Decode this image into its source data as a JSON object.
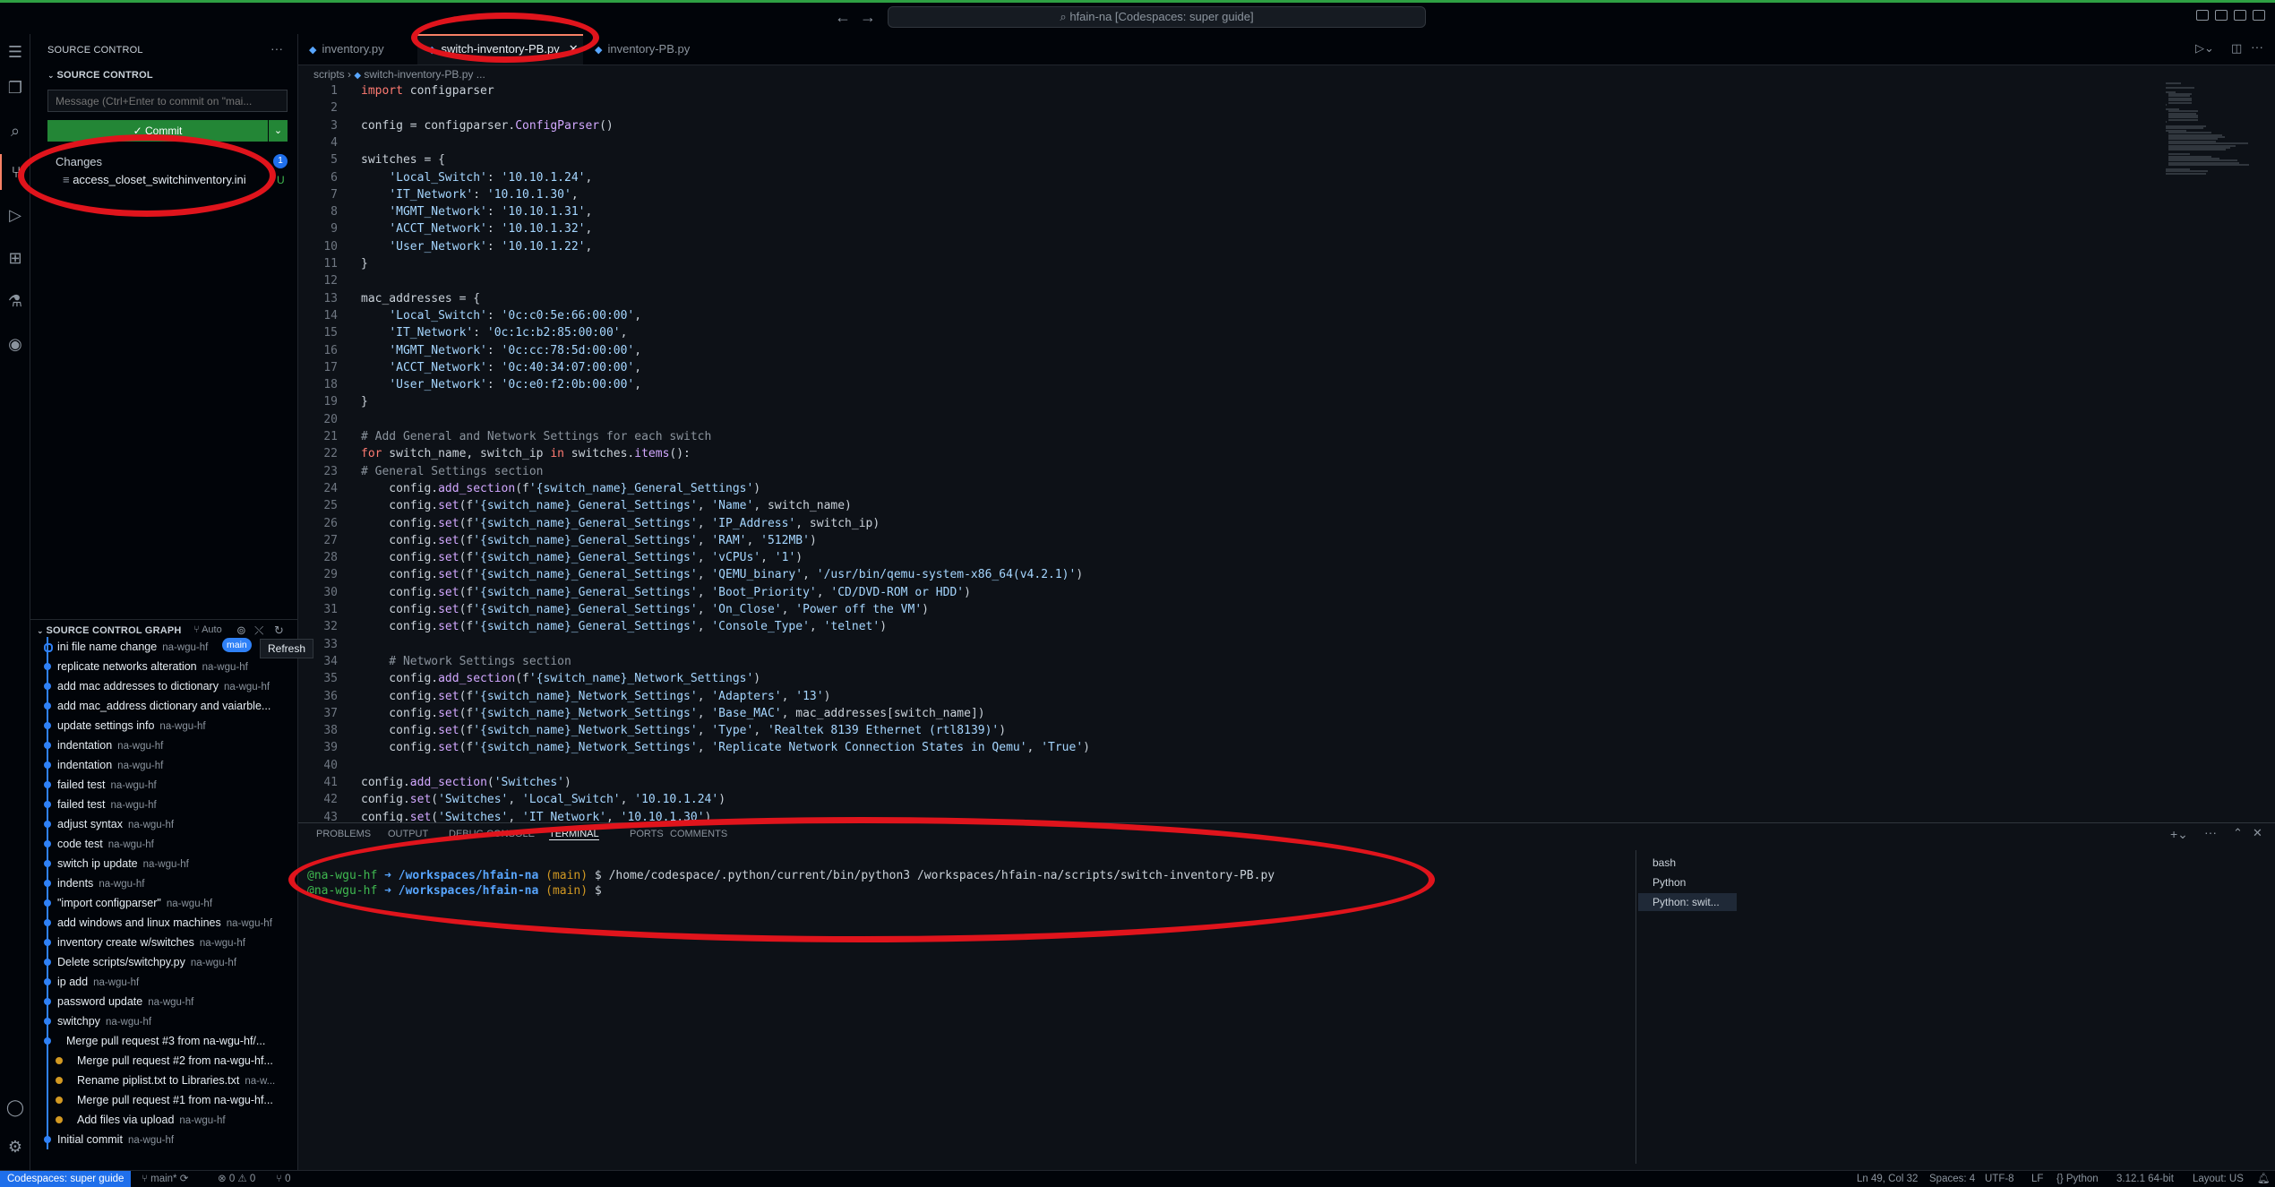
{
  "titlebar": {
    "search_text": "hfain-na [Codespaces: super guide]"
  },
  "sidebar": {
    "header": "SOURCE CONTROL",
    "section": "SOURCE CONTROL",
    "message_placeholder": "Message (Ctrl+Enter to commit on \"mai...",
    "commit_label": "✓ Commit",
    "changes_label": "Changes",
    "changes_count": "1",
    "changed_file": "access_closet_switchinventory.ini",
    "changed_file_status": "U",
    "graph_header": "SOURCE CONTROL GRAPH",
    "graph_auto": "Auto",
    "branch_pill": "main",
    "tooltip": "Refresh",
    "commits": [
      {
        "msg": "ini file name change",
        "author": "na-wgu-hf"
      },
      {
        "msg": "replicate networks alteration",
        "author": "na-wgu-hf"
      },
      {
        "msg": "add mac addresses to dictionary",
        "author": "na-wgu-hf"
      },
      {
        "msg": "add mac_address dictionary and vaiarble...",
        "author": ""
      },
      {
        "msg": "update settings info",
        "author": "na-wgu-hf"
      },
      {
        "msg": "indentation",
        "author": "na-wgu-hf"
      },
      {
        "msg": "indentation",
        "author": "na-wgu-hf"
      },
      {
        "msg": "failed test",
        "author": "na-wgu-hf"
      },
      {
        "msg": "failed test",
        "author": "na-wgu-hf"
      },
      {
        "msg": "adjust syntax",
        "author": "na-wgu-hf"
      },
      {
        "msg": "code test",
        "author": "na-wgu-hf"
      },
      {
        "msg": "switch ip update",
        "author": "na-wgu-hf"
      },
      {
        "msg": "indents",
        "author": "na-wgu-hf"
      },
      {
        "msg": "\"import configparser\"",
        "author": "na-wgu-hf"
      },
      {
        "msg": "add windows and linux machines",
        "author": "na-wgu-hf"
      },
      {
        "msg": "inventory create w/switches",
        "author": "na-wgu-hf"
      },
      {
        "msg": "Delete scripts/switchpy.py",
        "author": "na-wgu-hf"
      },
      {
        "msg": "ip add",
        "author": "na-wgu-hf"
      },
      {
        "msg": "password update",
        "author": "na-wgu-hf"
      },
      {
        "msg": "switchpy",
        "author": "na-wgu-hf"
      },
      {
        "msg": "Merge pull request #3 from na-wgu-hf/...",
        "author": ""
      },
      {
        "msg": "Merge pull request #2 from na-wgu-hf...",
        "author": ""
      },
      {
        "msg": "Rename piplist.txt to Libraries.txt",
        "author": "na-w..."
      },
      {
        "msg": "Merge pull request #1 from na-wgu-hf...",
        "author": ""
      },
      {
        "msg": "Add files via upload",
        "author": "na-wgu-hf"
      },
      {
        "msg": "Initial commit",
        "author": "na-wgu-hf"
      }
    ]
  },
  "editor": {
    "tabs": [
      {
        "label": "inventory.py"
      },
      {
        "label": "switch-inventory-PB.py"
      },
      {
        "label": "inventory-PB.py"
      }
    ],
    "breadcrumb": [
      "scripts",
      "switch-inventory-PB.py",
      "..."
    ],
    "code_lines": [
      "import configparser",
      "",
      "config = configparser.ConfigParser()",
      "",
      "switches = {",
      "    'Local_Switch': '10.10.1.24',",
      "    'IT_Network': '10.10.1.30',",
      "    'MGMT_Network': '10.10.1.31',",
      "    'ACCT_Network': '10.10.1.32',",
      "    'User_Network': '10.10.1.22',",
      "}",
      "",
      "mac_addresses = {",
      "    'Local_Switch': '0c:c0:5e:66:00:00',",
      "    'IT_Network': '0c:1c:b2:85:00:00',",
      "    'MGMT_Network': '0c:cc:78:5d:00:00',",
      "    'ACCT_Network': '0c:40:34:07:00:00',",
      "    'User_Network': '0c:e0:f2:0b:00:00',",
      "}",
      "",
      "# Add General and Network Settings for each switch",
      "for switch_name, switch_ip in switches.items():",
      "# General Settings section",
      "    config.add_section(f'{switch_name}_General_Settings')",
      "    config.set(f'{switch_name}_General_Settings', 'Name', switch_name)",
      "    config.set(f'{switch_name}_General_Settings', 'IP_Address', switch_ip)",
      "    config.set(f'{switch_name}_General_Settings', 'RAM', '512MB')",
      "    config.set(f'{switch_name}_General_Settings', 'vCPUs', '1')",
      "    config.set(f'{switch_name}_General_Settings', 'QEMU_binary', '/usr/bin/qemu-system-x86_64(v4.2.1)')",
      "    config.set(f'{switch_name}_General_Settings', 'Boot_Priority', 'CD/DVD-ROM or HDD')",
      "    config.set(f'{switch_name}_General_Settings', 'On_Close', 'Power off the VM')",
      "    config.set(f'{switch_name}_General_Settings', 'Console_Type', 'telnet')",
      "",
      "    # Network Settings section",
      "    config.add_section(f'{switch_name}_Network_Settings')",
      "    config.set(f'{switch_name}_Network_Settings', 'Adapters', '13')",
      "    config.set(f'{switch_name}_Network_Settings', 'Base_MAC', mac_addresses[switch_name])",
      "    config.set(f'{switch_name}_Network_Settings', 'Type', 'Realtek 8139 Ethernet (rtl8139)')",
      "    config.set(f'{switch_name}_Network_Settings', 'Replicate Network Connection States in Qemu', 'True')",
      "",
      "config.add_section('Switches')",
      "config.set('Switches', 'Local_Switch', '10.10.1.24')",
      "config.set('Switches', 'IT_Network', '10.10.1.30')"
    ]
  },
  "panel": {
    "tabs": [
      "PROBLEMS",
      "OUTPUT",
      "DEBUG CONSOLE",
      "TERMINAL",
      "PORTS",
      "COMMENTS"
    ],
    "terminal": [
      {
        "user": "@na-wgu-hf",
        "path": "➜ /workspaces/hfain-na",
        "branch": "(main)",
        "cmd": "$ /home/codespace/.python/current/bin/python3 /workspaces/hfain-na/scripts/switch-inventory-PB.py"
      },
      {
        "user": "@na-wgu-hf",
        "path": "➜ /workspaces/hfain-na",
        "branch": "(main)",
        "cmd": "$"
      }
    ],
    "terminals": [
      "bash",
      "Python",
      "Python: swit..."
    ]
  },
  "status": {
    "remote": "Codespaces: super guide",
    "branch": "main*",
    "problems": "⊗ 0 ⚠ 0",
    "ports": "⑂ 0",
    "cursor": "Ln 49, Col 32",
    "spaces": "Spaces: 4",
    "encoding": "UTF-8",
    "eol": "LF",
    "language": "Python",
    "interpreter": "3.12.1 64-bit",
    "layout": "Layout: US"
  },
  "colors": {
    "accent": "#2f81f7",
    "commit": "#238636",
    "annotation": "#e0141c"
  }
}
